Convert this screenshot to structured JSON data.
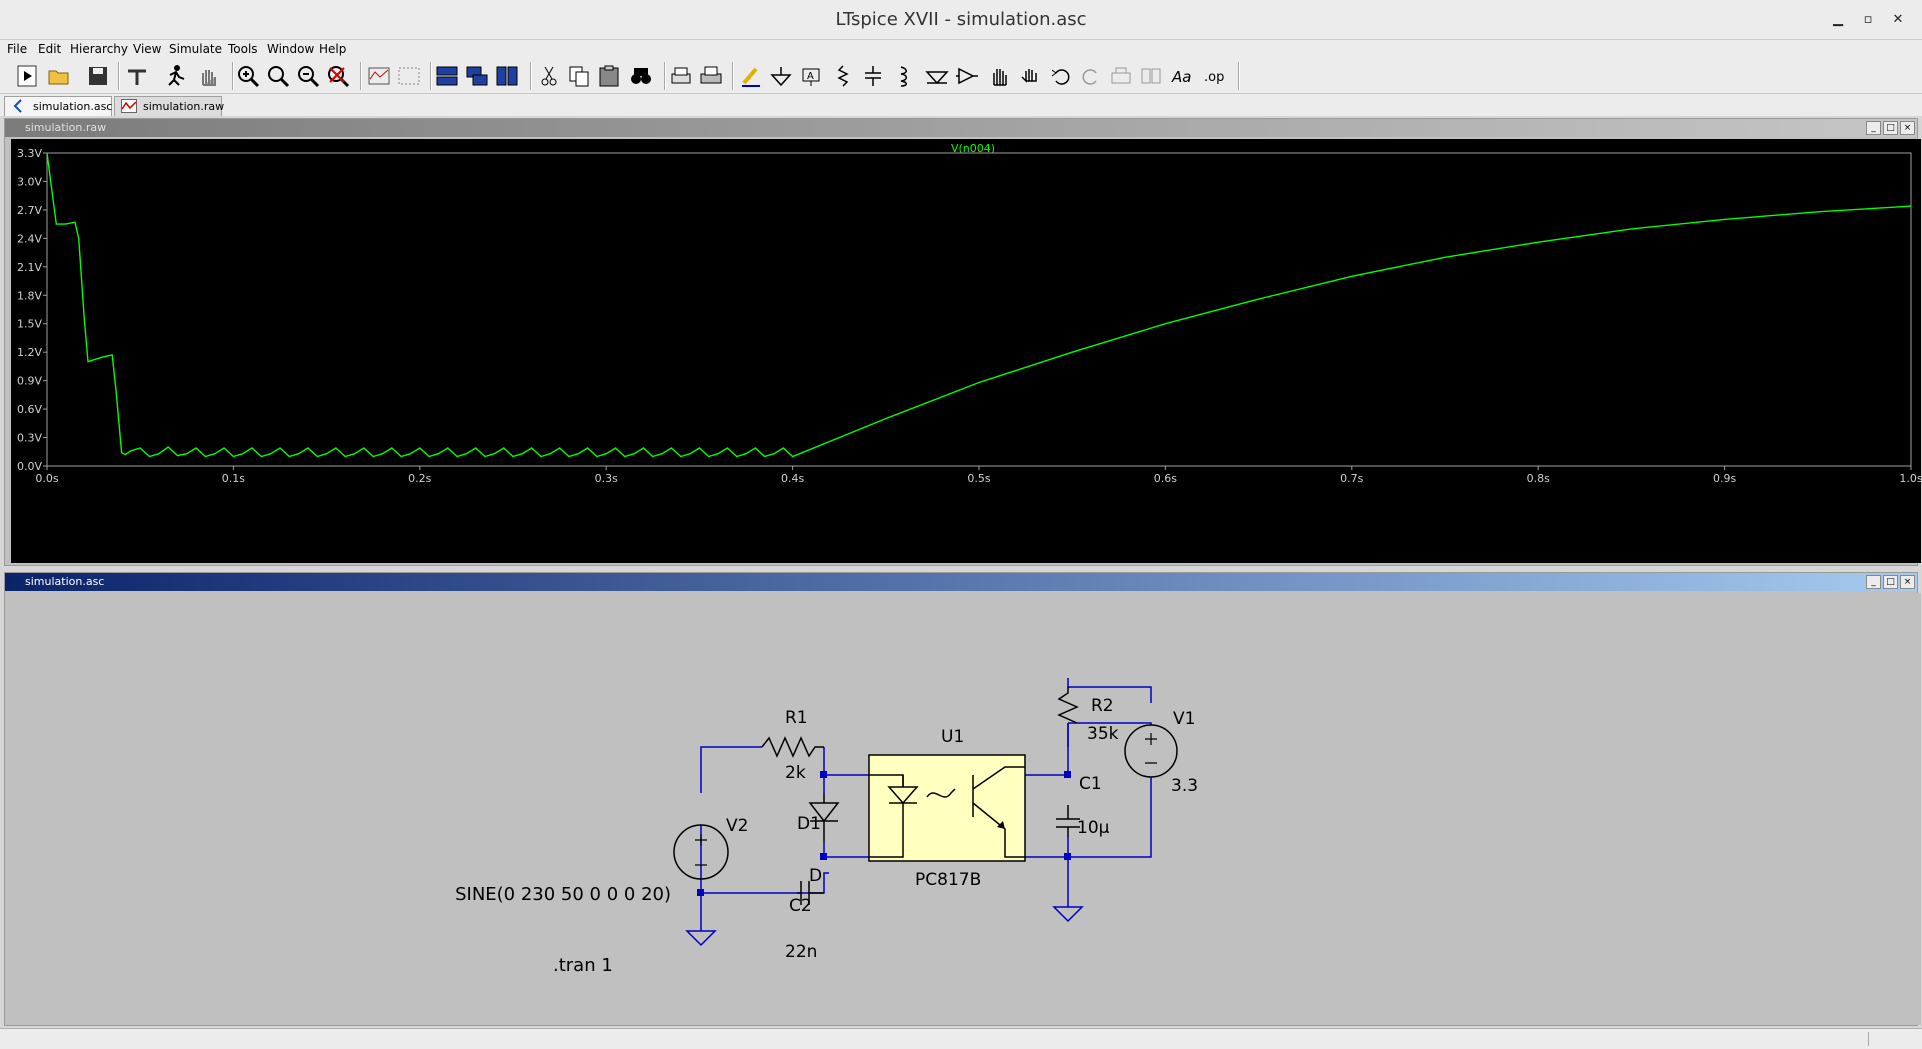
{
  "window": {
    "title": "LTspice XVII - simulation.asc"
  },
  "menu": {
    "file": "File",
    "edit": "Edit",
    "hierarchy": "Hierarchy",
    "view": "View",
    "simulate": "Simulate",
    "tools": "Tools",
    "window": "Window",
    "help": "Help"
  },
  "tabs": [
    {
      "label": "simulation.asc",
      "icon": "schematic-icon"
    },
    {
      "label": "simulation.raw",
      "icon": "waveform-icon"
    }
  ],
  "waveform_window": {
    "title": "simulation.raw"
  },
  "schematic_window": {
    "title": "simulation.asc"
  },
  "chart_data": {
    "type": "line",
    "title": "V(n004)",
    "series": [
      {
        "name": "V(n004)",
        "color": "#00ff00",
        "x": [
          0.0,
          0.002,
          0.005,
          0.01,
          0.015,
          0.017,
          0.02,
          0.022,
          0.025,
          0.03,
          0.035,
          0.037,
          0.04,
          0.042,
          0.045,
          0.05,
          0.055,
          0.06,
          0.065,
          0.07,
          0.075,
          0.08,
          0.085,
          0.09,
          0.095,
          0.1,
          0.105,
          0.11,
          0.115,
          0.12,
          0.125,
          0.13,
          0.135,
          0.14,
          0.145,
          0.15,
          0.155,
          0.16,
          0.165,
          0.17,
          0.175,
          0.18,
          0.185,
          0.19,
          0.195,
          0.2,
          0.205,
          0.21,
          0.215,
          0.22,
          0.225,
          0.23,
          0.235,
          0.24,
          0.245,
          0.25,
          0.255,
          0.26,
          0.265,
          0.27,
          0.275,
          0.28,
          0.285,
          0.29,
          0.295,
          0.3,
          0.305,
          0.31,
          0.315,
          0.32,
          0.325,
          0.33,
          0.335,
          0.34,
          0.345,
          0.35,
          0.355,
          0.36,
          0.365,
          0.37,
          0.375,
          0.38,
          0.385,
          0.39,
          0.395,
          0.4,
          0.45,
          0.5,
          0.55,
          0.6,
          0.65,
          0.7,
          0.75,
          0.8,
          0.85,
          0.9,
          0.95,
          1.0
        ],
        "y": [
          3.3,
          3.0,
          2.55,
          2.55,
          2.57,
          2.4,
          1.55,
          1.1,
          1.12,
          1.15,
          1.17,
          0.8,
          0.14,
          0.12,
          0.16,
          0.19,
          0.1,
          0.13,
          0.2,
          0.11,
          0.13,
          0.19,
          0.1,
          0.13,
          0.19,
          0.1,
          0.13,
          0.19,
          0.1,
          0.13,
          0.19,
          0.1,
          0.13,
          0.19,
          0.1,
          0.13,
          0.19,
          0.1,
          0.13,
          0.19,
          0.1,
          0.13,
          0.19,
          0.1,
          0.13,
          0.19,
          0.1,
          0.13,
          0.19,
          0.1,
          0.13,
          0.19,
          0.1,
          0.13,
          0.19,
          0.1,
          0.13,
          0.19,
          0.1,
          0.13,
          0.19,
          0.1,
          0.13,
          0.19,
          0.1,
          0.13,
          0.19,
          0.1,
          0.13,
          0.19,
          0.1,
          0.13,
          0.19,
          0.1,
          0.13,
          0.19,
          0.1,
          0.13,
          0.19,
          0.1,
          0.13,
          0.19,
          0.1,
          0.13,
          0.19,
          0.1,
          0.5,
          0.88,
          1.2,
          1.5,
          1.76,
          2.0,
          2.2,
          2.36,
          2.5,
          2.6,
          2.68,
          2.74
        ]
      }
    ],
    "xlim": [
      0.0,
      1.0
    ],
    "ylim": [
      0.0,
      3.3
    ],
    "xticks": [
      "0.0s",
      "0.1s",
      "0.2s",
      "0.3s",
      "0.4s",
      "0.5s",
      "0.6s",
      "0.7s",
      "0.8s",
      "0.9s",
      "1.0s"
    ],
    "yticks": [
      "0.0V",
      "0.3V",
      "0.6V",
      "0.9V",
      "1.2V",
      "1.5V",
      "1.8V",
      "2.1V",
      "2.4V",
      "2.7V",
      "3.0V",
      "3.3V"
    ],
    "grid": false,
    "background": "#000000",
    "axis_color": "#a0a0a0"
  },
  "schematic": {
    "wire_color": "#0000c0",
    "part_fill": "#ffffc0",
    "r1": {
      "ref": "R1",
      "value": "2k"
    },
    "r2": {
      "ref": "R2",
      "value": "35k"
    },
    "d1": {
      "ref": "D1",
      "value": "D"
    },
    "c1": {
      "ref": "C1",
      "value": "10µ"
    },
    "c2": {
      "ref": "C2",
      "value": "22n"
    },
    "v1": {
      "ref": "V1",
      "value": "3.3"
    },
    "v2": {
      "ref": "V2",
      "value": "SINE(0 230 50 0 0 0 20)"
    },
    "u1": {
      "ref": "U1",
      "value": "PC817B"
    },
    "directive": ".tran 1"
  }
}
